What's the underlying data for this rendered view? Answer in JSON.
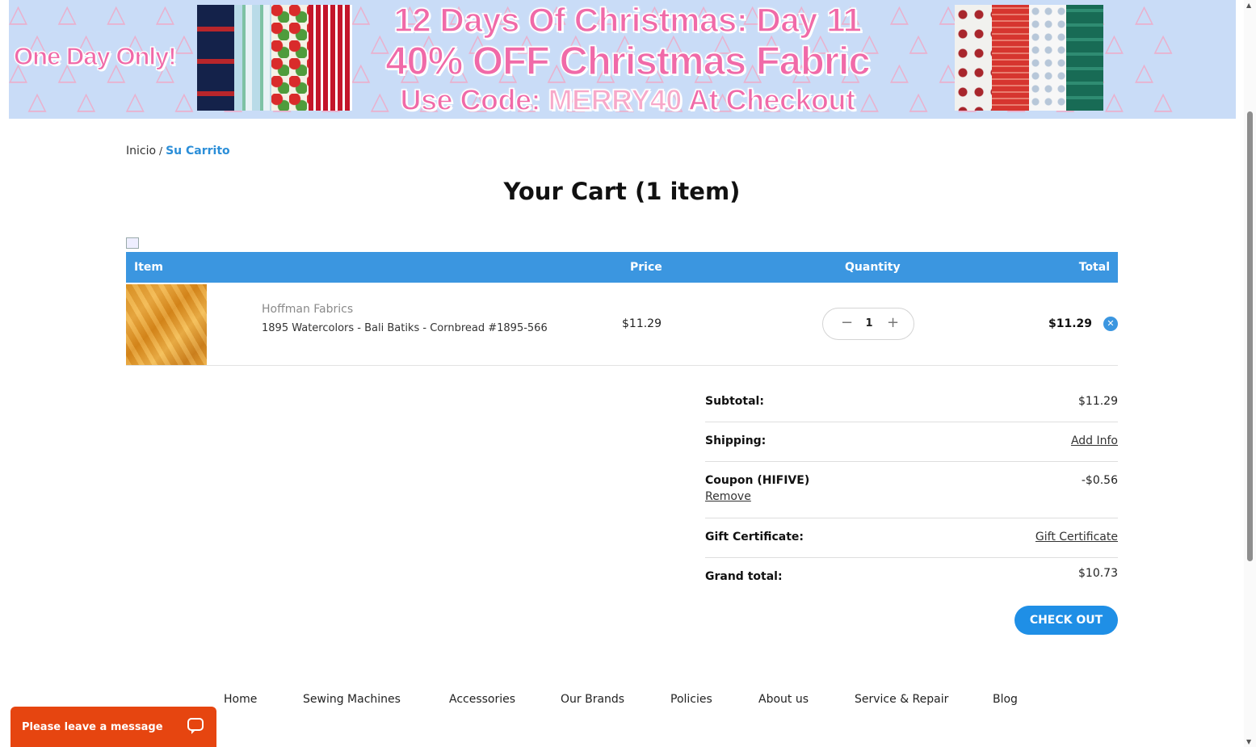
{
  "banner": {
    "left_text": "One Day Only!",
    "line1": "12 Days Of Christmas: Day 11",
    "line2": "40% OFF Christmas Fabric",
    "line3_prefix": "Use Code:",
    "line3_code": "MERRY40",
    "line3_suffix": "At Checkout",
    "colors": {
      "background": "#c9dcf7",
      "text_pink": "#f06aa8"
    }
  },
  "breadcrumb": {
    "home": "Inicio",
    "separator": "/",
    "current": "Su Carrito"
  },
  "page_title": "Your Cart (1 item)",
  "cart_table": {
    "headers": {
      "item": "Item",
      "price": "Price",
      "quantity": "Quantity",
      "total": "Total"
    },
    "items": [
      {
        "brand": "Hoffman Fabrics",
        "name": "1895 Watercolors - Bali Batiks - Cornbread #1895-566",
        "price": "$11.29",
        "quantity": "1",
        "total": "$11.29",
        "remove_icon": "close-icon"
      }
    ],
    "header_color": "#3b96e0"
  },
  "totals": {
    "subtotal_label": "Subtotal:",
    "subtotal_value": "$11.29",
    "shipping_label": "Shipping:",
    "shipping_link": "Add Info",
    "coupon_label": "Coupon (HIFIVE)",
    "coupon_value": "-$0.56",
    "coupon_remove": "Remove",
    "gift_label": "Gift Certificate:",
    "gift_link": "Gift Certificate",
    "grand_label": "Grand total:",
    "grand_value": "$10.73"
  },
  "checkout_label": "CHECK OUT",
  "footer_nav": [
    "Home",
    "Sewing Machines",
    "Accessories",
    "Our Brands",
    "Policies",
    "About us",
    "Service & Repair",
    "Blog"
  ],
  "chat": {
    "label": "Please leave a message",
    "icon": "chat-bubble-icon",
    "color": "#e64510"
  },
  "accent_color": "#1f8fe6"
}
